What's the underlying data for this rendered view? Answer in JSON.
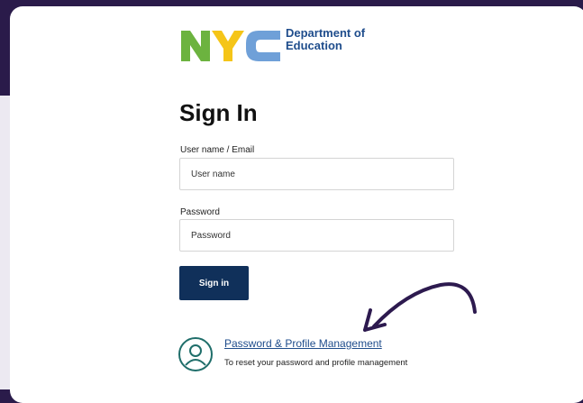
{
  "logo": {
    "line1": "Department of",
    "line2": "Education",
    "letters": "NYC"
  },
  "page_title": "Sign In",
  "username": {
    "label": "User name / Email",
    "placeholder": "User name"
  },
  "password": {
    "label": "Password",
    "placeholder": "Password"
  },
  "signin_button": "Sign in",
  "profile_management": {
    "link": "Password & Profile Management",
    "description": "To reset your password and profile management",
    "icon": "user-circle-icon"
  },
  "annotation": {
    "icon": "curved-arrow-icon"
  },
  "colors": {
    "background_dark": "#2a1b4a",
    "button": "#10305a",
    "link": "#1f4d8c",
    "nyc_green": "#6cb33f",
    "nyc_yellow": "#f5c518",
    "nyc_blue": "#6fa0d8",
    "icon_teal": "#1f6e6a"
  }
}
